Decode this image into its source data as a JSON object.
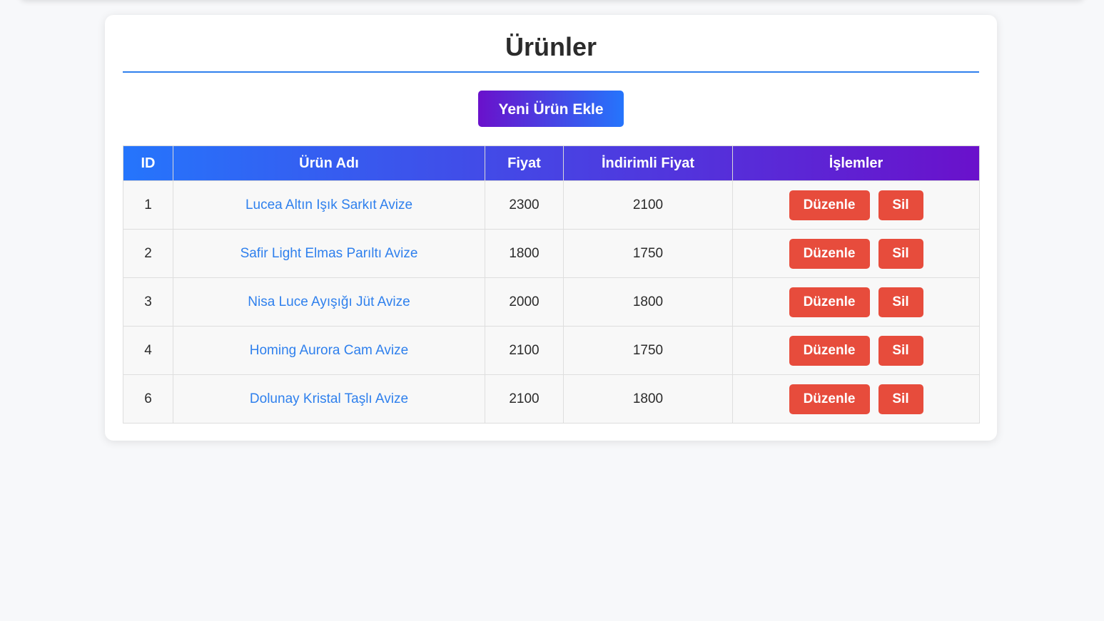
{
  "page": {
    "title": "Ürünler",
    "add_button_label": "Yeni Ürün Ekle"
  },
  "table": {
    "headers": [
      "ID",
      "Ürün Adı",
      "Fiyat",
      "İndirimli Fiyat",
      "İşlemler"
    ],
    "rows": [
      {
        "id": "1",
        "name": "Lucea Altın Işık Sarkıt Avize",
        "price": "2300",
        "discount_price": "2100",
        "edit": "Düzenle",
        "delete": "Sil"
      },
      {
        "id": "2",
        "name": "Safir Light Elmas Parıltı Avize",
        "price": "1800",
        "discount_price": "1750",
        "edit": "Düzenle",
        "delete": "Sil"
      },
      {
        "id": "3",
        "name": "Nisa Luce Ayışığı Jüt Avize",
        "price": "2000",
        "discount_price": "1800",
        "edit": "Düzenle",
        "delete": "Sil"
      },
      {
        "id": "4",
        "name": "Homing Aurora Cam Avize",
        "price": "2100",
        "discount_price": "1750",
        "edit": "Düzenle",
        "delete": "Sil"
      },
      {
        "id": "6",
        "name": "Dolunay Kristal Taşlı Avize",
        "price": "2100",
        "discount_price": "1800",
        "edit": "Düzenle",
        "delete": "Sil"
      }
    ]
  },
  "colors": {
    "accent": "#2f80ed",
    "gradient_start": "#6a11cb",
    "gradient_end": "#2575fc",
    "danger": "#e74c3c"
  }
}
